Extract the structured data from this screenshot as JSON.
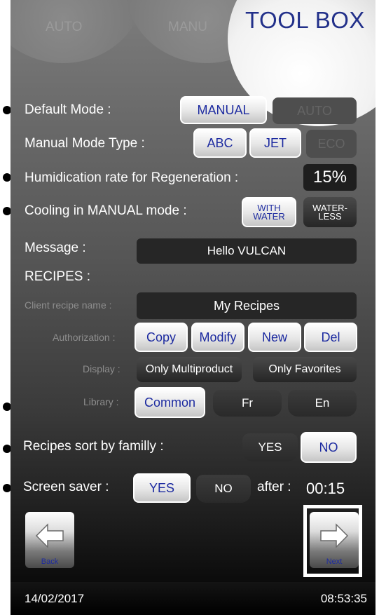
{
  "tabs": {
    "auto": "AUTO",
    "manu": "MANU",
    "toolbox": "TOOL BOX"
  },
  "default_mode": {
    "label": "Default Mode :",
    "manual": "MANUAL",
    "auto": "AUTO"
  },
  "manual_mode_type": {
    "label": "Manual Mode Type :",
    "abc": "ABC",
    "jet": "JET",
    "eco": "ECO"
  },
  "humidification": {
    "label": "Humidication rate for Regeneration :",
    "value": "15%"
  },
  "cooling": {
    "label": "Cooling in MANUAL mode :",
    "with_water": "WITH WATER",
    "waterless": "WATER- LESS"
  },
  "message": {
    "label": "Message :",
    "value": "Hello VULCAN"
  },
  "recipes": {
    "heading": "RECIPES :",
    "client_name_label": "Client recipe name :",
    "client_name_value": "My Recipes",
    "authorization_label": "Authorization :",
    "copy": "Copy",
    "modify": "Modify",
    "new": "New",
    "del": "Del",
    "display_label": "Display :",
    "only_multiproduct": "Only Multiproduct",
    "only_favorites": "Only Favorites",
    "library_label": "Library :",
    "common": "Common",
    "fr": "Fr",
    "en": "En"
  },
  "sort": {
    "label": "Recipes sort by familly :",
    "yes": "YES",
    "no": "NO"
  },
  "screen_saver": {
    "label": "Screen saver :",
    "yes": "YES",
    "no": "NO",
    "after": "after :",
    "time": "00:15"
  },
  "nav": {
    "back": "Back",
    "next": "Next"
  },
  "status": {
    "date": "14/02/2017",
    "time": "08:53:35"
  }
}
